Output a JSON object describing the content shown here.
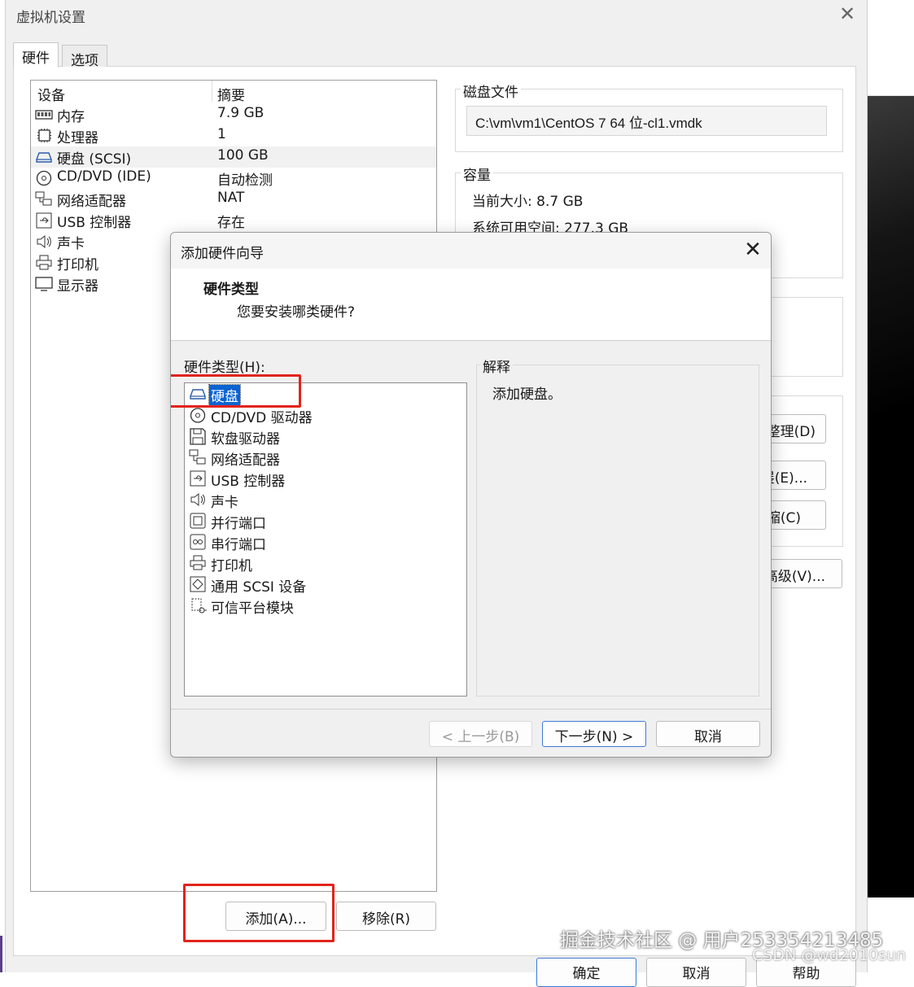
{
  "main_window": {
    "title": "虚拟机设置",
    "tabs": [
      {
        "label": "硬件"
      },
      {
        "label": "选项"
      }
    ],
    "device_list": {
      "headers": {
        "device": "设备",
        "summary": "摘要"
      },
      "rows": [
        {
          "name": "内存",
          "summary": "7.9 GB",
          "icon": "memory-icon"
        },
        {
          "name": "处理器",
          "summary": "1",
          "icon": "cpu-icon"
        },
        {
          "name": "硬盘 (SCSI)",
          "summary": "100 GB",
          "icon": "harddisk-icon"
        },
        {
          "name": "CD/DVD (IDE)",
          "summary": "自动检测",
          "icon": "cdrom-icon"
        },
        {
          "name": "网络适配器",
          "summary": "NAT",
          "icon": "network-icon"
        },
        {
          "name": "USB 控制器",
          "summary": "存在",
          "icon": "usb-icon"
        },
        {
          "name": "声卡",
          "summary": "",
          "icon": "speaker-icon"
        },
        {
          "name": "打印机",
          "summary": "",
          "icon": "printer-icon"
        },
        {
          "name": "显示器",
          "summary": "",
          "icon": "monitor-icon"
        }
      ]
    },
    "disk_file": {
      "label": "磁盘文件",
      "value": "C:\\vm\\vm1\\CentOS 7 64 位-cl1.vmdk"
    },
    "capacity": {
      "label": "容量",
      "current_size": "当前大小: 8.7 GB",
      "free_space": "系统可用空间: 277.3 GB"
    },
    "side_buttons": [
      {
        "label": "整理(D)",
        "visible_text": "整理(D)"
      },
      {
        "label": "扩展(E)...",
        "visible_text": "展(E)..."
      },
      {
        "label": "压缩(C)",
        "visible_text": "缩(C)"
      },
      {
        "label": "高级(V)...",
        "visible_text": "高级(V)..."
      }
    ],
    "add_button": "添加(A)...",
    "remove_button": "移除(R)",
    "ok_button": "确定",
    "cancel_button": "取消",
    "help_button": "帮助"
  },
  "dialog": {
    "title": "添加硬件向导",
    "heading": "硬件类型",
    "subheading": "您要安装哪类硬件?",
    "hardware_types_label": "硬件类型(H):",
    "hardware_types": [
      {
        "label": "硬盘",
        "icon": "harddisk-icon",
        "selected": true
      },
      {
        "label": "CD/DVD 驱动器",
        "icon": "cdrom-icon"
      },
      {
        "label": "软盘驱动器",
        "icon": "floppy-icon"
      },
      {
        "label": "网络适配器",
        "icon": "network-icon"
      },
      {
        "label": "USB 控制器",
        "icon": "usb-icon"
      },
      {
        "label": "声卡",
        "icon": "speaker-icon"
      },
      {
        "label": "并行端口",
        "icon": "parallel-port-icon"
      },
      {
        "label": "串行端口",
        "icon": "serial-port-icon"
      },
      {
        "label": "打印机",
        "icon": "printer-icon"
      },
      {
        "label": "通用 SCSI 设备",
        "icon": "scsi-icon"
      },
      {
        "label": "可信平台模块",
        "icon": "tpm-icon"
      }
    ],
    "explanation_label": "解释",
    "explanation_text": "添加硬盘。",
    "back_button": "< 上一步(B)",
    "next_button": "下一步(N) >",
    "cancel_button": "取消"
  },
  "watermarks": {
    "line1": "掘金技术社区 @ 用户253354213485",
    "line2": "CSDN @wd2010sun"
  },
  "colors": {
    "selection": "#0a64d2",
    "highlight_box": "#e2231a",
    "primary_border": "#3d7ad6"
  }
}
